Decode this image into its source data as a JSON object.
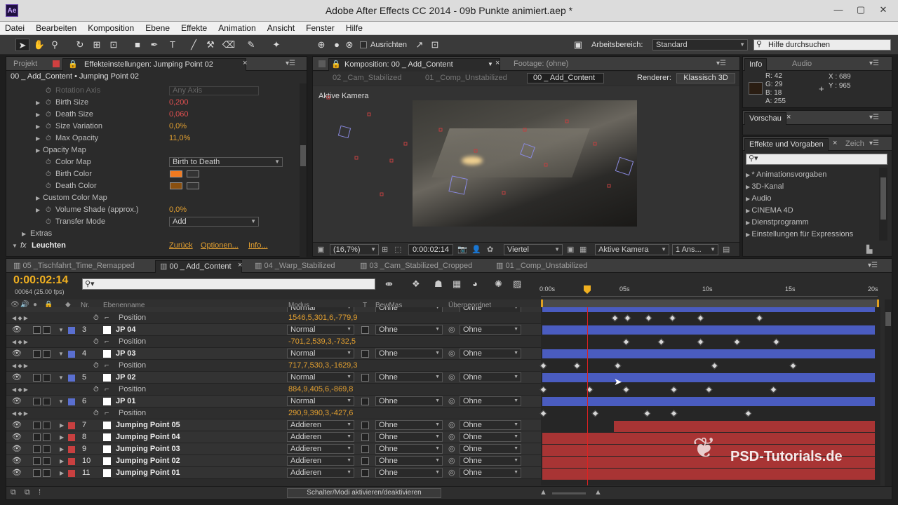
{
  "window": {
    "title": "Adobe After Effects CC 2014 - 09b Punkte animiert.aep *",
    "app_badge": "Ae"
  },
  "menu": [
    "Datei",
    "Bearbeiten",
    "Komposition",
    "Ebene",
    "Effekte",
    "Animation",
    "Ansicht",
    "Fenster",
    "Hilfe"
  ],
  "toolbar": {
    "align_label": "Ausrichten",
    "workspace_label": "Arbeitsbereich:",
    "workspace_value": "Standard",
    "help_placeholder": "Hilfe durchsuchen"
  },
  "left_panel": {
    "tab_projekt": "Projekt",
    "tab_effects": "Effekteinstellungen: Jumping Point 02",
    "crumb": "00 _ Add_Content • Jumping Point 02",
    "props": [
      {
        "name": "Rotation Axis",
        "value": "Any Axis"
      },
      {
        "name": "Birth Size",
        "value": "0,200"
      },
      {
        "name": "Death Size",
        "value": "0,060"
      },
      {
        "name": "Size Variation",
        "value": "0,0%"
      },
      {
        "name": "Max Opacity",
        "value": "11,0%"
      },
      {
        "name": "Opacity Map",
        "value": ""
      },
      {
        "name": "Color Map",
        "value": "Birth to Death"
      },
      {
        "name": "Birth Color",
        "value": ""
      },
      {
        "name": "Death Color",
        "value": ""
      },
      {
        "name": "Custom Color Map",
        "value": ""
      },
      {
        "name": "Volume Shade (approx.)",
        "value": "0,0%"
      },
      {
        "name": "Transfer Mode",
        "value": "Add"
      },
      {
        "name": "Extras",
        "value": ""
      }
    ],
    "fx": {
      "name": "Leuchten",
      "back": "Zurück",
      "options": "Optionen...",
      "info": "Info..."
    },
    "colors": {
      "birth": "#f07a20",
      "death": "#8a5010"
    }
  },
  "viewer": {
    "tab_comp": "Komposition: 00 _ Add_Content",
    "tab_footage": "Footage: (ohne)",
    "crumbs": [
      "02 _Cam_Stabilized",
      "01 _Comp_Unstabilized",
      "00 _ Add_Content"
    ],
    "renderer_label": "Renderer:",
    "renderer_value": "Klassisch 3D",
    "camera_label": "Aktive Kamera",
    "zoom": "(16,7%)",
    "timecode": "0:00:02:14",
    "quality": "Viertel",
    "view": "Aktive Kamera",
    "views": "1 Ans..."
  },
  "info_panel": {
    "tab_info": "Info",
    "tab_audio": "Audio",
    "r": "R: 42",
    "g": "G: 29",
    "b": "B: 18",
    "a": "A: 255",
    "x": "X : 689",
    "y": "Y : 965",
    "swatch": "#2a1d12"
  },
  "preview_panel": {
    "tab": "Vorschau"
  },
  "effects_panel": {
    "tab": "Effekte und Vorgaben",
    "tab2": "Zeich",
    "items": [
      "* Animationsvorgaben",
      "3D-Kanal",
      "Audio",
      "CINEMA 4D",
      "Dienstprogramm",
      "Einstellungen für Expressions"
    ]
  },
  "timeline": {
    "tabs": [
      "05 _Tischfahrt_Time_Remapped",
      "00 _ Add_Content",
      "04 _Warp_Stabilized",
      "03 _Cam_Stabilized_Cropped",
      "01 _Comp_Unstabilized"
    ],
    "timecode": "0:00:02:14",
    "frames": "00064 (25.00 fps)",
    "col_nr": "Nr.",
    "col_name": "Ebenenname",
    "col_mode": "Modus",
    "col_t": "T",
    "col_bewmas": "BewMas",
    "col_parent": "Übergeordnet",
    "ruler": [
      "0:00s",
      "05s",
      "10s",
      "15s",
      "20s"
    ],
    "top_row": {
      "mode": "Normal",
      "parent": "Ohne"
    },
    "layers": [
      {
        "nr": "",
        "name": "",
        "sub": "Position",
        "pos": "1546,5,301,6,-779,9",
        "color": "#5a6fd0",
        "mode": "",
        "parent": "",
        "type": "sub"
      },
      {
        "nr": "3",
        "name": "JP 04",
        "sub": "Position",
        "pos": "-701,2,539,3,-732,5",
        "color": "#5a6fd0",
        "mode": "Normal",
        "parent": "Ohne",
        "type": "jp"
      },
      {
        "nr": "4",
        "name": "JP 03",
        "sub": "Position",
        "pos": "717,7,530,3,-1629,3",
        "color": "#5a6fd0",
        "mode": "Normal",
        "parent": "Ohne",
        "type": "jp"
      },
      {
        "nr": "5",
        "name": "JP 02",
        "sub": "Position",
        "pos": "884,9,405,6,-869,8",
        "color": "#5a6fd0",
        "mode": "Normal",
        "parent": "Ohne",
        "type": "jp"
      },
      {
        "nr": "6",
        "name": "JP 01",
        "sub": "Position",
        "pos": "290,9,390,3,-427,6",
        "color": "#5a6fd0",
        "mode": "Normal",
        "parent": "Ohne",
        "type": "jp"
      },
      {
        "nr": "7",
        "name": "Jumping Point 05",
        "mode": "Addieren",
        "parent": "Ohne",
        "color": "#c84040",
        "type": "red"
      },
      {
        "nr": "8",
        "name": "Jumping Point 04",
        "mode": "Addieren",
        "parent": "Ohne",
        "color": "#c84040",
        "type": "red"
      },
      {
        "nr": "9",
        "name": "Jumping Point 03",
        "mode": "Addieren",
        "parent": "Ohne",
        "color": "#c84040",
        "type": "red"
      },
      {
        "nr": "10",
        "name": "Jumping Point 02",
        "mode": "Addieren",
        "parent": "Ohne",
        "color": "#c84040",
        "type": "red"
      },
      {
        "nr": "11",
        "name": "Jumping Point 01",
        "mode": "Addieren",
        "parent": "Ohne",
        "color": "#c84040",
        "type": "red"
      }
    ],
    "bewmas": "Ohne",
    "footer_toggle": "Schalter/Modi aktivieren/deaktivieren",
    "watermark": "PSD-Tutorials.de"
  }
}
